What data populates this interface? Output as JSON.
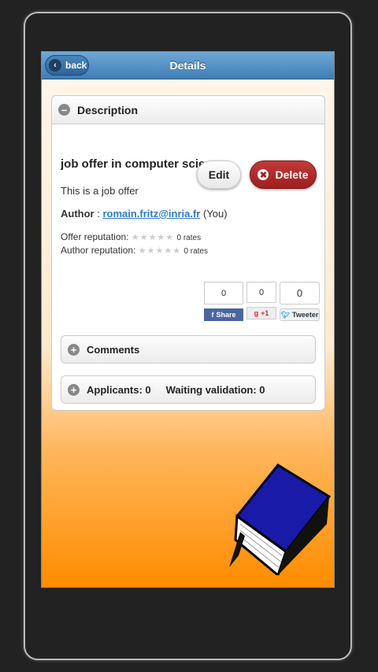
{
  "header": {
    "back_label": "back",
    "title": "Details"
  },
  "description": {
    "header": "Description",
    "job_title": "job offer in computer science",
    "edit_label": "Edit",
    "delete_label": "Delete",
    "body": "This is a job offer",
    "author_label": "Author",
    "author_sep": " : ",
    "author_email": "romain.fritz@inria.fr",
    "author_suffix": " (You)",
    "offer_reputation_label": "Offer reputation:",
    "offer_rates": "0 rates",
    "offer_rating": 0,
    "author_reputation_label": "Author reputation:",
    "author_rates": "0 rates",
    "author_rating": 0
  },
  "social": {
    "facebook": {
      "count": "0",
      "label": "Share"
    },
    "google": {
      "count": "0",
      "label": "+1"
    },
    "twitter": {
      "count": "0",
      "label": "Tweeter"
    }
  },
  "sections": {
    "comments": "Comments",
    "applicants": "Applicants: 0",
    "waiting": "Waiting validation: 0"
  },
  "colors": {
    "header": "#4f8cc4",
    "delete": "#b02a2a",
    "link": "#2a7bc5",
    "background_bottom": "#ff8c00"
  }
}
